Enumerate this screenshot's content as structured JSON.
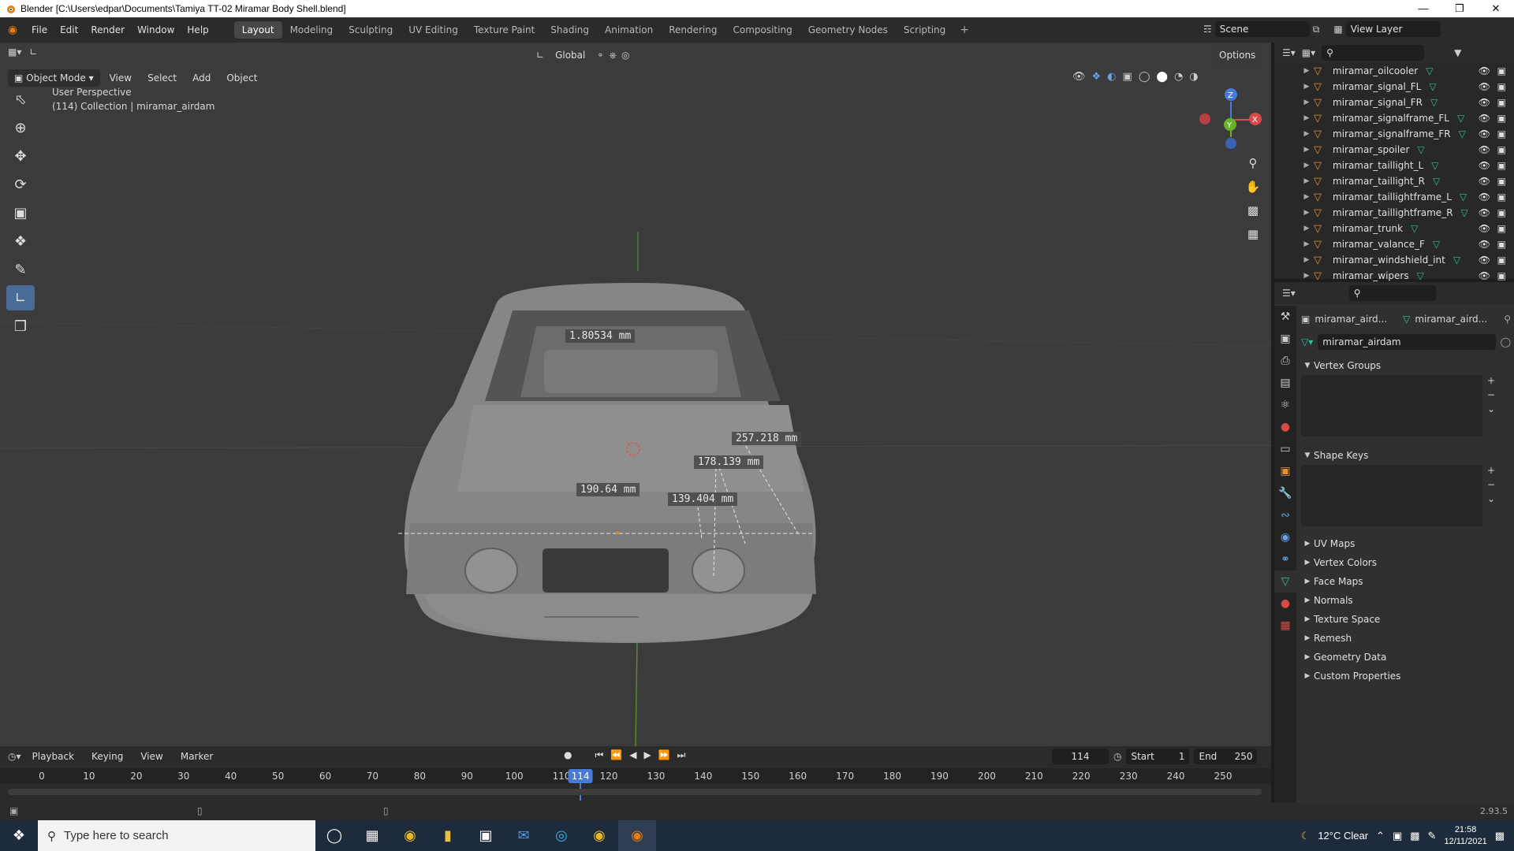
{
  "titlebar": {
    "title": "Blender [C:\\Users\\edpar\\Documents\\Tamiya TT-02 Miramar Body Shell.blend]"
  },
  "menu": [
    "File",
    "Edit",
    "Render",
    "Window",
    "Help"
  ],
  "workspaces": [
    "Layout",
    "Modeling",
    "Sculpting",
    "UV Editing",
    "Texture Paint",
    "Shading",
    "Animation",
    "Rendering",
    "Compositing",
    "Geometry Nodes",
    "Scripting"
  ],
  "active_workspace": "Layout",
  "scene": {
    "label": "Scene",
    "view_layer": "View Layer"
  },
  "viewport_header": {
    "orientation": "Global",
    "options": "Options",
    "mode": "Object Mode",
    "menus": [
      "View",
      "Select",
      "Add",
      "Object"
    ]
  },
  "viewport": {
    "perspective": "User Perspective",
    "collection_info": "(114) Collection | miramar_airdam",
    "measurements": [
      "1.80534 mm",
      "257.218 mm",
      "178.139 mm",
      "190.64 mm",
      "139.404 mm"
    ]
  },
  "outliner": {
    "items": [
      {
        "name": "miramar_oilcooler"
      },
      {
        "name": "miramar_signal_FL"
      },
      {
        "name": "miramar_signal_FR"
      },
      {
        "name": "miramar_signalframe_FL"
      },
      {
        "name": "miramar_signalframe_FR"
      },
      {
        "name": "miramar_spoiler"
      },
      {
        "name": "miramar_taillight_L"
      },
      {
        "name": "miramar_taillight_R"
      },
      {
        "name": "miramar_taillightframe_L"
      },
      {
        "name": "miramar_taillightframe_R"
      },
      {
        "name": "miramar_trunk"
      },
      {
        "name": "miramar_valance_F"
      },
      {
        "name": "miramar_windshield_int"
      },
      {
        "name": "miramar_wipers"
      }
    ]
  },
  "properties": {
    "breadcrumb_object": "miramar_aird...",
    "breadcrumb_data": "miramar_aird...",
    "mesh_name": "miramar_airdam",
    "panels_open": [
      "Vertex Groups",
      "Shape Keys"
    ],
    "panels_closed": [
      "UV Maps",
      "Vertex Colors",
      "Face Maps",
      "Normals",
      "Texture Space",
      "Remesh",
      "Geometry Data",
      "Custom Properties"
    ]
  },
  "timeline": {
    "menus": [
      "Playback",
      "Keying",
      "View",
      "Marker"
    ],
    "current_frame": "114",
    "start_label": "Start",
    "start": "1",
    "end_label": "End",
    "end": "250",
    "ticks": [
      "0",
      "10",
      "20",
      "30",
      "40",
      "50",
      "60",
      "70",
      "80",
      "90",
      "100",
      "110",
      "120",
      "130",
      "140",
      "150",
      "160",
      "170",
      "180",
      "190",
      "200",
      "210",
      "220",
      "230",
      "240",
      "250"
    ],
    "playhead": "114"
  },
  "statusbar": {
    "version": "2.93.5"
  },
  "taskbar": {
    "search_placeholder": "Type here to search",
    "weather": "12°C  Clear",
    "time": "21:58",
    "date": "12/11/2021"
  }
}
